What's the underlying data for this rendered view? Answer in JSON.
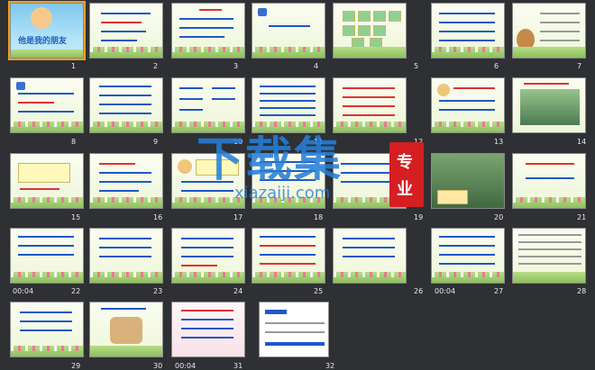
{
  "slides": [
    {
      "num": "1",
      "title": "他是我的朋友"
    },
    {
      "num": "2"
    },
    {
      "num": "3"
    },
    {
      "num": "4"
    },
    {
      "num": "5"
    },
    {
      "num": "6"
    },
    {
      "num": "7"
    },
    {
      "num": "8"
    },
    {
      "num": "9"
    },
    {
      "num": "10"
    },
    {
      "num": "11"
    },
    {
      "num": "12"
    },
    {
      "num": "13"
    },
    {
      "num": "14"
    },
    {
      "num": "15"
    },
    {
      "num": "16"
    },
    {
      "num": "17"
    },
    {
      "num": "18"
    },
    {
      "num": "19"
    },
    {
      "num": "20"
    },
    {
      "num": "21"
    },
    {
      "num": "22",
      "time": "00:04"
    },
    {
      "num": "23"
    },
    {
      "num": "24"
    },
    {
      "num": "25"
    },
    {
      "num": "26"
    },
    {
      "num": "27",
      "time": "00:04"
    },
    {
      "num": "28"
    },
    {
      "num": "29"
    },
    {
      "num": "30"
    },
    {
      "num": "31",
      "time": "00:04"
    },
    {
      "num": "32"
    }
  ],
  "watermark": {
    "main": "下载集",
    "url": "xiazaiji.com",
    "seal_top": "专",
    "seal_bottom": "业"
  },
  "colors": {
    "background": "#2f3034",
    "border": "#8a8a8a",
    "accent_blue": "#1f58c7",
    "accent_red": "#d33"
  }
}
